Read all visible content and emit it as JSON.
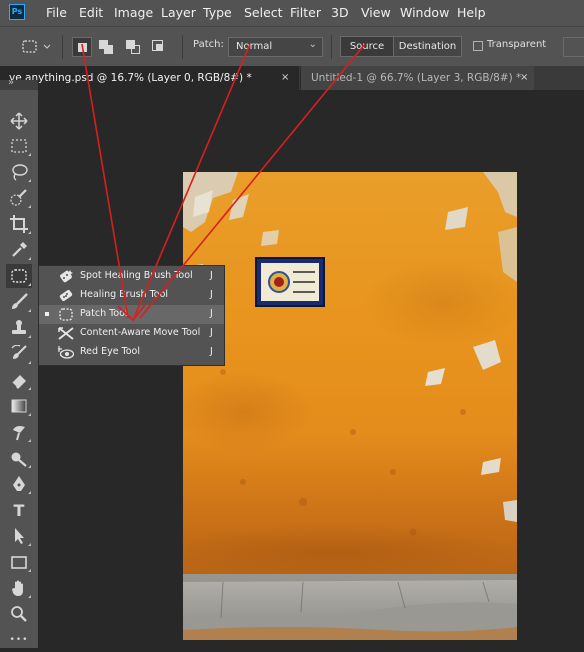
{
  "app": {
    "logo_text": "Ps"
  },
  "menu": [
    "File",
    "Edit",
    "Image",
    "Layer",
    "Type",
    "Select",
    "Filter",
    "3D",
    "View",
    "Window",
    "Help"
  ],
  "options": {
    "patch_label": "Patch:",
    "patch_mode": "Normal",
    "source_label": "Source",
    "destination_label": "Destination",
    "active_segment": "Source",
    "transparent_label": "Transparent",
    "transparent_checked": false
  },
  "tabs": [
    {
      "label": "ve anything.psd @ 16.7% (Layer 0, RGB/8#) *",
      "close": "×",
      "active": true
    },
    {
      "label": "Untitled-1 @ 66.7% (Layer 3, RGB/8#) *",
      "close": "×",
      "active": false
    }
  ],
  "toolbar": {
    "collapse": "»",
    "tools": [
      "move-tool",
      "marquee-tool",
      "lasso-tool",
      "quick-selection-tool",
      "crop-tool",
      "eyedropper-tool",
      "patch-tool",
      "brush-tool",
      "clone-stamp-tool",
      "history-brush-tool",
      "eraser-tool",
      "gradient-tool",
      "blur-tool",
      "dodge-tool",
      "pen-tool",
      "type-tool",
      "path-selection-tool",
      "rectangle-tool",
      "hand-tool",
      "zoom-tool",
      "more-tools"
    ],
    "type_glyph": "T",
    "more_glyph": "•••"
  },
  "flyout": {
    "items": [
      {
        "label": "Spot Healing Brush Tool",
        "key": "J",
        "icon": "spot-healing-brush-icon",
        "selected": false
      },
      {
        "label": "Healing Brush Tool",
        "key": "J",
        "icon": "healing-brush-icon",
        "selected": false
      },
      {
        "label": "Patch Tool",
        "key": "J",
        "icon": "patch-icon",
        "selected": true
      },
      {
        "label": "Content-Aware Move Tool",
        "key": "J",
        "icon": "content-aware-move-icon",
        "selected": false
      },
      {
        "label": "Red Eye Tool",
        "key": "J",
        "icon": "red-eye-icon",
        "selected": false
      }
    ]
  },
  "colors": {
    "wall_orange": "#e8961e",
    "annotation_red": "#d81f1f",
    "ui_panel": "#535353",
    "workspace": "#282828"
  }
}
